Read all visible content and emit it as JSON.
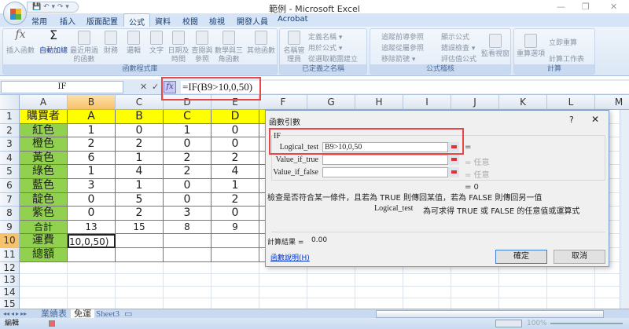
{
  "window": {
    "title": "範例 - Microsoft Excel",
    "minimize": "—",
    "restore": "❐",
    "close": "✕"
  },
  "qat": {
    "items": "💾 ↶ ▾ ↷ ▾"
  },
  "tabs": [
    "常用",
    "插入",
    "版面配置",
    "公式",
    "資料",
    "校閱",
    "檢視",
    "開發人員",
    "Acrobat"
  ],
  "ribbon": {
    "groups": [
      {
        "label": "函數程式庫",
        "buttons": [
          "插入函數",
          "自動加總",
          "最近用過的函數",
          "財務",
          "邏輯",
          "文字",
          "日期及時間",
          "查閱與參照",
          "數學與三角函數",
          "其他函數"
        ]
      },
      {
        "label": "已定義之名稱",
        "buttons": [
          "名稱管理員"
        ],
        "small": [
          "定義名稱 ▾",
          "用於公式 ▾",
          "從選取範圍建立"
        ]
      },
      {
        "label": "公式稽核",
        "small": [
          "追蹤前導參照",
          "追蹤從屬參照",
          "移除箭號 ▾",
          "顯示公式",
          "錯誤檢查 ▾",
          "評估值公式"
        ],
        "buttons": [
          "監看視窗"
        ]
      },
      {
        "label": "計算",
        "buttons": [
          "重算選項"
        ],
        "small": [
          "立即重算",
          "計算工作表"
        ]
      }
    ]
  },
  "formula_bar": {
    "name_box": "IF",
    "fx": "fx",
    "cancel": "✕",
    "enter": "✓",
    "formula": "=IF(B9>10,0,50)"
  },
  "columns": [
    "A",
    "B",
    "C",
    "D",
    "E",
    "F",
    "G",
    "H",
    "I",
    "J",
    "K",
    "L",
    "M"
  ],
  "rows": [
    [
      "購買者",
      "A",
      "B",
      "C",
      "D"
    ],
    [
      "紅色",
      "1",
      "0",
      "1",
      "0"
    ],
    [
      "橙色",
      "2",
      "2",
      "0",
      "0"
    ],
    [
      "黃色",
      "6",
      "1",
      "2",
      "2"
    ],
    [
      "綠色",
      "1",
      "4",
      "2",
      "4"
    ],
    [
      "藍色",
      "3",
      "1",
      "0",
      "1"
    ],
    [
      "靛色",
      "0",
      "5",
      "0",
      "2"
    ],
    [
      "紫色",
      "0",
      "2",
      "3",
      "0"
    ],
    [
      "合計",
      "13",
      "15",
      "8",
      "9"
    ],
    [
      "運費",
      "10,0,50)",
      "",
      "",
      ""
    ],
    [
      "總額",
      "",
      "",
      "",
      ""
    ],
    [
      "",
      "",
      "",
      "",
      ""
    ],
    [
      "",
      "",
      "",
      "",
      ""
    ],
    [
      "",
      "",
      "",
      "",
      ""
    ],
    [
      "",
      "",
      "",
      "",
      ""
    ]
  ],
  "sheet_tabs": [
    "業績表",
    "免運",
    "Sheet3"
  ],
  "status": {
    "mode": "編輯",
    "zoom": "100%"
  },
  "dialog": {
    "title": "函數引數",
    "help": "?",
    "close": "✕",
    "function": "IF",
    "args": [
      {
        "label": "Logical_test",
        "value": "B9>10,0,50",
        "result": "="
      },
      {
        "label": "Value_if_true",
        "value": "",
        "result": "= 任意"
      },
      {
        "label": "Value_if_false",
        "value": "",
        "result": "= 任意"
      }
    ],
    "overall": "= 0",
    "description": "檢查是否符合某一條件，且若為 TRUE 則傳回某值，若為 FALSE 則傳回另一值",
    "arg_help_name": "Logical_test",
    "arg_help": "為可求得 TRUE 或 FALSE 的任意值或運算式",
    "calc_label": "計算結果 =",
    "calc_value": "0.00",
    "help_link": "函數說明(H)",
    "ok": "確定",
    "cancel": "取消"
  },
  "colors": {
    "yellow": "#ffff00",
    "green": "#92d050",
    "accent": "#e8474a"
  }
}
